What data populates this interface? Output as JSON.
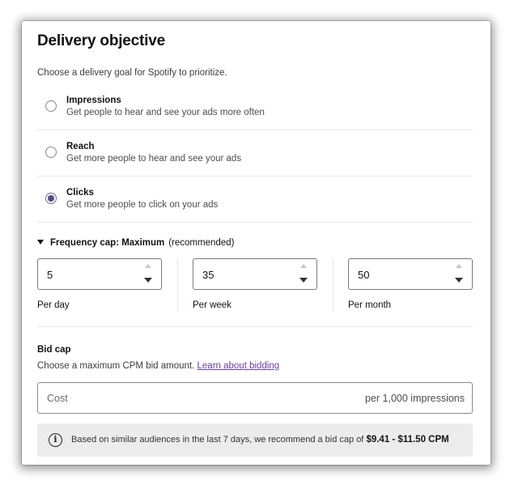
{
  "panel": {
    "title": "Delivery objective",
    "subtitle": "Choose a delivery goal for Spotify to prioritize."
  },
  "options": [
    {
      "label": "Impressions",
      "description": "Get people to hear and see your ads more often",
      "selected": false
    },
    {
      "label": "Reach",
      "description": "Get more people to hear and see your ads",
      "selected": false
    },
    {
      "label": "Clicks",
      "description": "Get more people to click on your ads",
      "selected": true
    }
  ],
  "frequency_cap": {
    "heading": "Frequency cap: Maximum",
    "note": "(recommended)",
    "fields": [
      {
        "value": "5",
        "label": "Per day"
      },
      {
        "value": "35",
        "label": "Per week"
      },
      {
        "value": "50",
        "label": "Per month"
      }
    ]
  },
  "bid_cap": {
    "title": "Bid cap",
    "description": "Choose a maximum CPM bid amount.",
    "link": "Learn about bidding",
    "placeholder": "Cost",
    "suffix": "per 1,000 impressions"
  },
  "info": {
    "text": "Based on similar audiences in the last 7 days, we recommend a bid cap of",
    "range": "$9.41 - $11.50 CPM"
  },
  "colors": {
    "radio_selected": "#5b4a86",
    "link": "#6b3fa0",
    "info_background": "#ececec"
  },
  "icons": {
    "info": "info-circle-icon",
    "collapse": "triangle-down-icon"
  }
}
